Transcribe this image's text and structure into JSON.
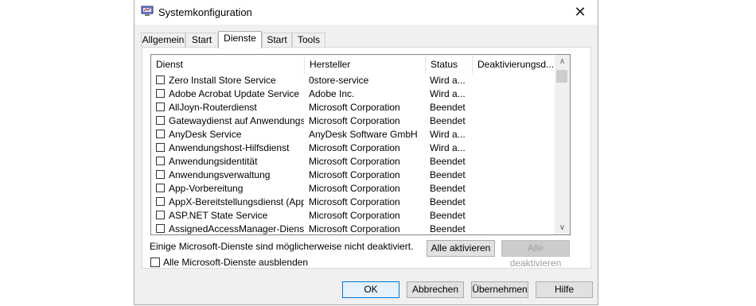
{
  "window": {
    "title": "Systemkonfiguration",
    "app_icon": "msconfig-icon",
    "close_glyph": "✕"
  },
  "tabs": [
    {
      "label": "Allgemein"
    },
    {
      "label": "Start"
    },
    {
      "label": "Dienste",
      "active": true
    },
    {
      "label": "Start"
    },
    {
      "label": "Tools"
    }
  ],
  "services": {
    "columns": [
      "Dienst",
      "Hersteller",
      "Status",
      "Deaktivierungsd..."
    ],
    "rows": [
      {
        "name": "Zero Install Store Service",
        "vendor": "0store-service",
        "status": "Wird a..."
      },
      {
        "name": "Adobe Acrobat Update Service",
        "vendor": "Adobe Inc.",
        "status": "Wird a..."
      },
      {
        "name": "AllJoyn-Routerdienst",
        "vendor": "Microsoft Corporation",
        "status": "Beendet"
      },
      {
        "name": "Gatewaydienst auf Anwendungs...",
        "vendor": "Microsoft Corporation",
        "status": "Beendet"
      },
      {
        "name": "AnyDesk Service",
        "vendor": "AnyDesk Software GmbH",
        "status": "Wird a..."
      },
      {
        "name": "Anwendungshost-Hilfsdienst",
        "vendor": "Microsoft Corporation",
        "status": "Wird a..."
      },
      {
        "name": "Anwendungsidentität",
        "vendor": "Microsoft Corporation",
        "status": "Beendet"
      },
      {
        "name": "Anwendungsverwaltung",
        "vendor": "Microsoft Corporation",
        "status": "Beendet"
      },
      {
        "name": "App-Vorbereitung",
        "vendor": "Microsoft Corporation",
        "status": "Beendet"
      },
      {
        "name": "AppX-Bereitstellungsdienst (App...",
        "vendor": "Microsoft Corporation",
        "status": "Beendet"
      },
      {
        "name": "ASP.NET State Service",
        "vendor": "Microsoft Corporation",
        "status": "Beendet"
      },
      {
        "name": "AssignedAccessManager-Dienst",
        "vendor": "Microsoft Corporation",
        "status": "Beendet"
      }
    ],
    "scroll_up_glyph": "∧",
    "scroll_down_glyph": "∨"
  },
  "note": "Einige Microsoft-Dienste sind möglicherweise nicht deaktiviert.",
  "buttons": {
    "enable_all": "Alle aktivieren",
    "disable_all": "Alle deaktivieren",
    "ok": "OK",
    "cancel": "Abbrechen",
    "apply": "Übernehmen",
    "help": "Hilfe"
  },
  "hide_ms_label": "Alle Microsoft-Dienste ausblenden"
}
